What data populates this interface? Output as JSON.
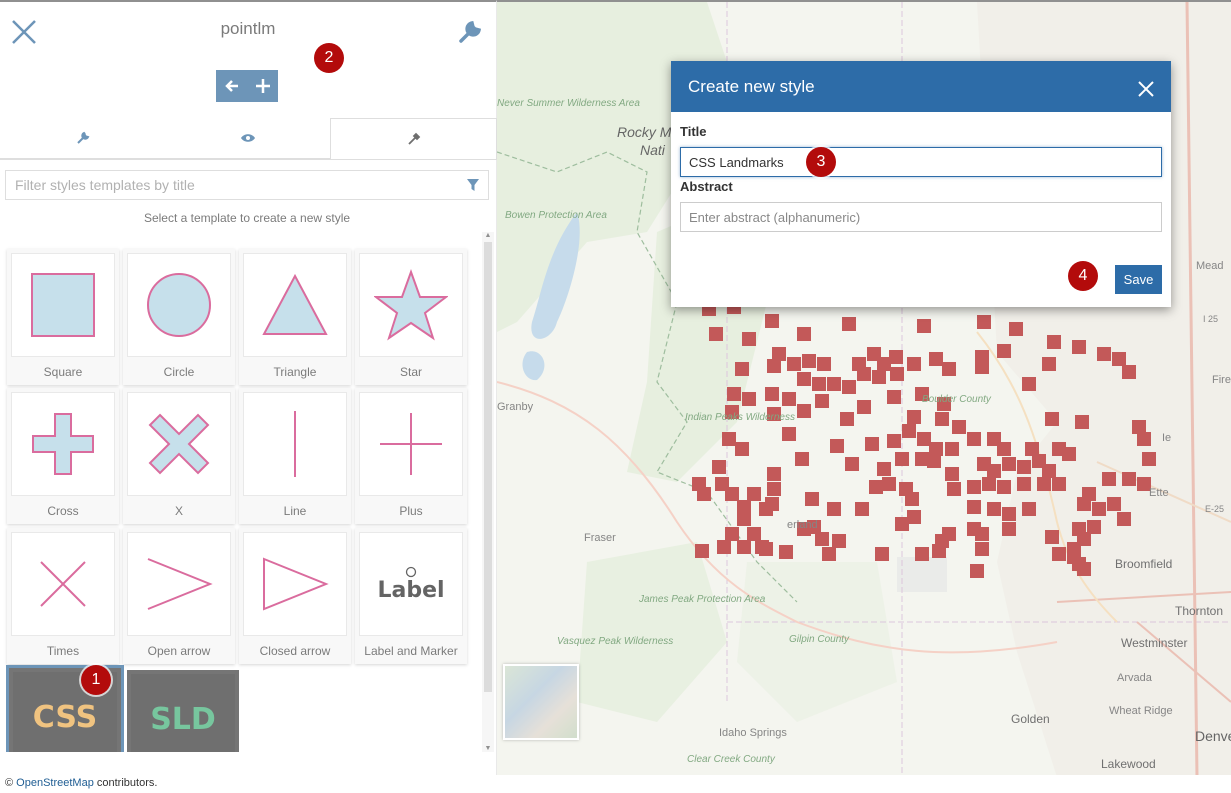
{
  "panel": {
    "title": "pointlm",
    "filter_placeholder": "Filter styles templates by title",
    "hint": "Select a template to create a new style",
    "templates": [
      {
        "label": "Square"
      },
      {
        "label": "Circle"
      },
      {
        "label": "Triangle"
      },
      {
        "label": "Star"
      },
      {
        "label": "Cross"
      },
      {
        "label": "X"
      },
      {
        "label": "Line"
      },
      {
        "label": "Plus"
      },
      {
        "label": "Times"
      },
      {
        "label": "Open arrow"
      },
      {
        "label": "Closed arrow"
      },
      {
        "label": "Label and Marker"
      },
      {
        "label": "CSS"
      },
      {
        "label": "SLD"
      }
    ],
    "label_marker_text": "Label"
  },
  "modal": {
    "title": "Create new style",
    "title_label": "Title",
    "title_value": "CSS Landmarks",
    "abstract_label": "Abstract",
    "abstract_placeholder": "Enter abstract (alphanumeric)",
    "save_label": "Save"
  },
  "badges": [
    "1",
    "2",
    "3",
    "4"
  ],
  "map": {
    "labels": [
      "Never Summer Wilderness Area",
      "Rocky M",
      "Nati",
      "Bowen Protection Area",
      "Indian Peaks Wilderness",
      "Granby",
      "Fraser",
      "James Peak Protection Area",
      "Vasquez Peak Wilderness",
      "Gilpin County",
      "Idaho Springs",
      "Clear Creek County",
      "erland",
      "Broomfield",
      "Thornton",
      "Westminster",
      "Arvada",
      "Wheat Ridge",
      "Golden",
      "Denver",
      "Lakewood",
      "Mead",
      "I 25",
      "Boulder County",
      "Firest",
      "Ette",
      "Ie",
      "E-25"
    ]
  },
  "attribution": {
    "prefix": "©",
    "link": "OpenStreetMap",
    "suffix": "contributors."
  },
  "colors": {
    "accent": "#1f5d93",
    "modal_header": "#2d6ca8",
    "badge": "#b30b0b",
    "marker": "#a30000",
    "symbol_fill": "#a8cfe0",
    "symbol_stroke": "#c71e6a",
    "css_logo": "#e8a33d",
    "sld_logo": "#2fa86b"
  }
}
